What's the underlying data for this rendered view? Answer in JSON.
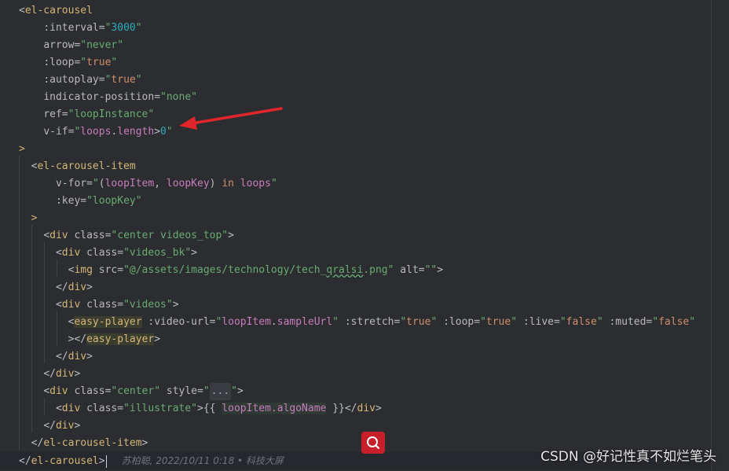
{
  "editor": {
    "lines": [
      {
        "tokens": [
          [
            "punc",
            "<"
          ],
          [
            "tag",
            "el-carousel"
          ]
        ]
      },
      {
        "indent": "    ",
        "tokens": [
          [
            "attr",
            ":interval="
          ],
          [
            "str",
            "\""
          ],
          [
            "num",
            "3000"
          ],
          [
            "str",
            "\""
          ]
        ]
      },
      {
        "indent": "    ",
        "tokens": [
          [
            "attr",
            "arrow="
          ],
          [
            "str",
            "\"never\""
          ]
        ]
      },
      {
        "indent": "    ",
        "tokens": [
          [
            "attr",
            ":loop="
          ],
          [
            "str",
            "\""
          ],
          [
            "kw",
            "true"
          ],
          [
            "str",
            "\""
          ]
        ]
      },
      {
        "indent": "    ",
        "tokens": [
          [
            "attr",
            ":autoplay="
          ],
          [
            "str",
            "\""
          ],
          [
            "kw",
            "true"
          ],
          [
            "str",
            "\""
          ]
        ]
      },
      {
        "indent": "    ",
        "tokens": [
          [
            "attr",
            "indicator-position="
          ],
          [
            "str",
            "\"none\""
          ]
        ]
      },
      {
        "indent": "    ",
        "tokens": [
          [
            "attr",
            "ref="
          ],
          [
            "str",
            "\"loopInstance\""
          ]
        ]
      },
      {
        "indent": "    ",
        "tokens": [
          [
            "attr",
            "v-if="
          ],
          [
            "str",
            "\""
          ],
          [
            "var",
            "loops"
          ],
          [
            "punc",
            "."
          ],
          [
            "var",
            "length"
          ],
          [
            "punc",
            ">"
          ],
          [
            "num",
            "0"
          ],
          [
            "str",
            "\""
          ]
        ]
      },
      {
        "tokens": [
          [
            "tag",
            ">"
          ]
        ]
      },
      {
        "indent": "  ",
        "tokens": [
          [
            "punc",
            "<"
          ],
          [
            "tag",
            "el-carousel-item"
          ]
        ]
      },
      {
        "indent": "      ",
        "tokens": [
          [
            "attr",
            "v-for="
          ],
          [
            "str",
            "\""
          ],
          [
            "punc",
            "("
          ],
          [
            "var",
            "loopItem"
          ],
          [
            "punc",
            ", "
          ],
          [
            "var",
            "loopKey"
          ],
          [
            "punc",
            ") "
          ],
          [
            "kw",
            "in "
          ],
          [
            "var",
            "loops"
          ],
          [
            "str",
            "\""
          ]
        ]
      },
      {
        "indent": "      ",
        "tokens": [
          [
            "attr",
            ":key="
          ],
          [
            "str",
            "\"loopKey\""
          ]
        ]
      },
      {
        "indent": "  ",
        "tokens": [
          [
            "tag",
            ">"
          ]
        ]
      },
      {
        "indent": "    ",
        "tokens": [
          [
            "punc",
            "<"
          ],
          [
            "tag",
            "div "
          ],
          [
            "attr",
            "class="
          ],
          [
            "str",
            "\"center videos_top\""
          ],
          [
            "punc",
            ">"
          ]
        ]
      },
      {
        "indent": "      ",
        "tokens": [
          [
            "punc",
            "<"
          ],
          [
            "tag",
            "div "
          ],
          [
            "attr",
            "class="
          ],
          [
            "str",
            "\"videos_bk\""
          ],
          [
            "punc",
            ">"
          ]
        ]
      },
      {
        "indent": "        ",
        "tokens": [
          [
            "punc",
            "<"
          ],
          [
            "tag",
            "img "
          ],
          [
            "attr",
            "src="
          ],
          [
            "str",
            "\"@/assets/images/technology/tech_"
          ],
          [
            "sq",
            "qralsi"
          ],
          [
            "str",
            ".png\" "
          ],
          [
            "attr",
            "alt="
          ],
          [
            "str",
            "\"\""
          ],
          [
            "punc",
            ">"
          ]
        ]
      },
      {
        "indent": "      ",
        "tokens": [
          [
            "punc",
            "</"
          ],
          [
            "tag",
            "div"
          ],
          [
            "punc",
            ">"
          ]
        ]
      },
      {
        "indent": "      ",
        "tokens": [
          [
            "punc",
            "<"
          ],
          [
            "tag",
            "div "
          ],
          [
            "attr",
            "class="
          ],
          [
            "str",
            "\"videos\""
          ],
          [
            "punc",
            ">"
          ]
        ]
      },
      {
        "indent": "        ",
        "tokens": [
          [
            "punc",
            "<"
          ],
          [
            "hltag",
            "easy-player"
          ],
          [
            "attr",
            " :video-url="
          ],
          [
            "str",
            "\""
          ],
          [
            "var",
            "loopItem"
          ],
          [
            "punc",
            "."
          ],
          [
            "var",
            "sampleUrl"
          ],
          [
            "str",
            "\" "
          ],
          [
            "attr",
            ":stretch="
          ],
          [
            "str",
            "\""
          ],
          [
            "kw",
            "true"
          ],
          [
            "str",
            "\" "
          ],
          [
            "attr",
            ":loop="
          ],
          [
            "str",
            "\""
          ],
          [
            "kw",
            "true"
          ],
          [
            "str",
            "\" "
          ],
          [
            "attr",
            ":live="
          ],
          [
            "str",
            "\""
          ],
          [
            "kw",
            "false"
          ],
          [
            "str",
            "\" "
          ],
          [
            "attr",
            ":muted="
          ],
          [
            "str",
            "\""
          ],
          [
            "kw",
            "false"
          ],
          [
            "str",
            "\""
          ]
        ]
      },
      {
        "indent": "        ",
        "tokens": [
          [
            "punc",
            "></"
          ],
          [
            "hltag",
            "easy-player"
          ],
          [
            "punc",
            ">"
          ]
        ]
      },
      {
        "indent": "      ",
        "tokens": [
          [
            "punc",
            "</"
          ],
          [
            "tag",
            "div"
          ],
          [
            "punc",
            ">"
          ]
        ]
      },
      {
        "indent": "    ",
        "tokens": [
          [
            "punc",
            "</"
          ],
          [
            "tag",
            "div"
          ],
          [
            "punc",
            ">"
          ]
        ]
      },
      {
        "indent": "    ",
        "tokens": [
          [
            "punc",
            "<"
          ],
          [
            "tag",
            "div "
          ],
          [
            "attr",
            "class="
          ],
          [
            "str",
            "\"center\" "
          ],
          [
            "attr",
            "style="
          ],
          [
            "str",
            "\""
          ],
          [
            "fold",
            "..."
          ],
          [
            "str",
            "\""
          ],
          [
            "punc",
            ">"
          ]
        ]
      },
      {
        "indent": "      ",
        "tokens": [
          [
            "punc",
            "<"
          ],
          [
            "tag",
            "div "
          ],
          [
            "attr",
            "class="
          ],
          [
            "str",
            "\"illustrate\""
          ],
          [
            "punc",
            ">{{ "
          ],
          [
            "hlvar",
            "loopItem.algoName"
          ],
          [
            "punc",
            " }}</"
          ],
          [
            "tag",
            "div"
          ],
          [
            "punc",
            ">"
          ]
        ]
      },
      {
        "indent": "    ",
        "tokens": [
          [
            "punc",
            "</"
          ],
          [
            "tag",
            "div"
          ],
          [
            "punc",
            ">"
          ]
        ]
      },
      {
        "indent": "  ",
        "tokens": [
          [
            "punc",
            "</"
          ],
          [
            "tag",
            "el-carousel-item"
          ],
          [
            "punc",
            ">"
          ]
        ]
      },
      {
        "current": true,
        "tokens": [
          [
            "punc",
            "</"
          ],
          [
            "tag",
            "el-carousel"
          ],
          [
            "punc",
            ">"
          ],
          [
            "caret",
            ""
          ],
          [
            "inlay",
            "     苏柏聪, 2022/10/11 0:18 • 科技大屏"
          ]
        ]
      }
    ]
  },
  "watermark": "CSDN @好记性真不如烂笔头",
  "colors": {
    "arrow": "#e0262b",
    "badge": "#c8202a"
  }
}
